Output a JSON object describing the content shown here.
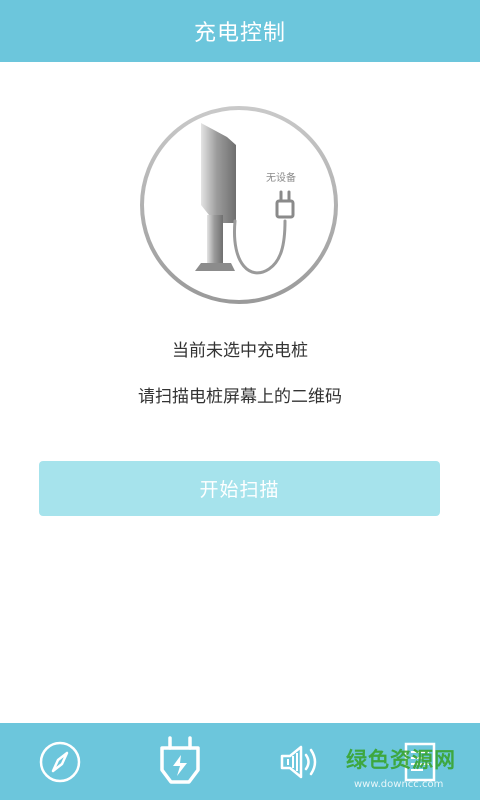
{
  "header": {
    "title": "充电控制"
  },
  "status": {
    "device_badge": "无设备",
    "line1": "当前未选中充电桩",
    "line2": "请扫描电桩屏幕上的二维码"
  },
  "actions": {
    "scan_label": "开始扫描"
  },
  "tabbar": {
    "items": [
      {
        "icon": "compass-icon"
      },
      {
        "icon": "charger-plug-icon",
        "active": true
      },
      {
        "icon": "speaker-icon"
      },
      {
        "icon": "document-icon"
      }
    ]
  },
  "watermark": {
    "text": "绿色资源网",
    "sub": "www.downcc.com"
  },
  "colors": {
    "accent": "#6cc6dc",
    "button": "#a6e3ec"
  }
}
